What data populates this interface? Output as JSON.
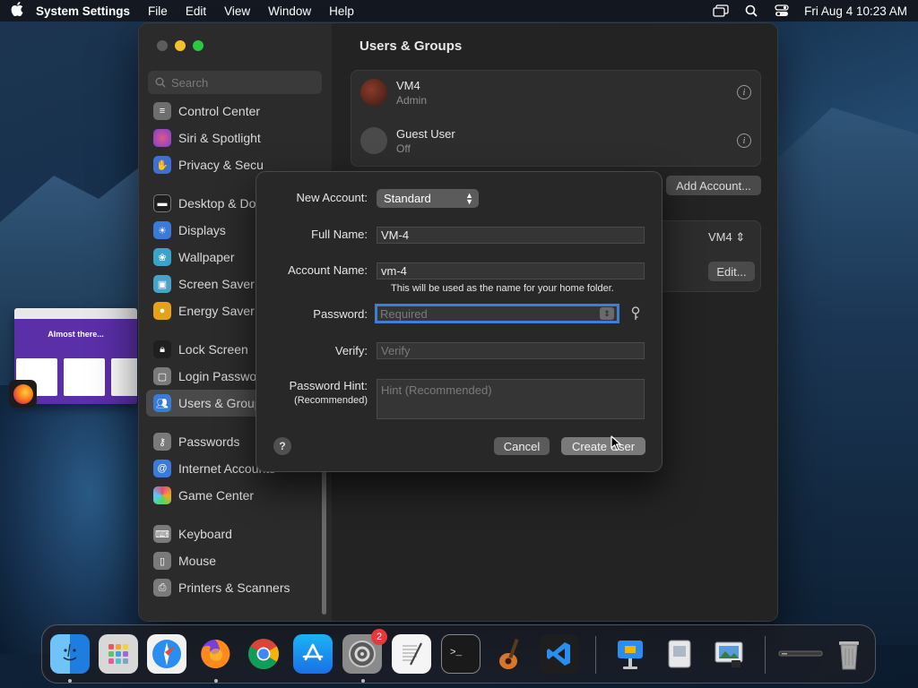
{
  "menubar": {
    "app_name": "System Settings",
    "items": [
      "File",
      "Edit",
      "View",
      "Window",
      "Help"
    ],
    "clock": "Fri Aug 4  10:23 AM"
  },
  "sidebar": {
    "search_placeholder": "Search",
    "items": [
      {
        "label": "Control Center",
        "icon": "control-center-icon",
        "color": "#6e6e6e"
      },
      {
        "label": "Siri & Spotlight",
        "icon": "siri-icon",
        "color": "#c23fa0"
      },
      {
        "label": "Privacy & Secu",
        "icon": "hand-icon",
        "color": "#3e6fd1"
      },
      {
        "label": "Desktop & Doc",
        "icon": "desktop-icon",
        "color": "#1f1f1f"
      },
      {
        "label": "Displays",
        "icon": "sun-icon",
        "color": "#3b7bd8"
      },
      {
        "label": "Wallpaper",
        "icon": "wallpaper-icon",
        "color": "#3aa3c9"
      },
      {
        "label": "Screen Saver",
        "icon": "screensaver-icon",
        "color": "#47a3c8"
      },
      {
        "label": "Energy Saver",
        "icon": "bulb-icon",
        "color": "#e5a11a"
      },
      {
        "label": "Lock Screen",
        "icon": "lock-icon",
        "color": "#1f1f1f"
      },
      {
        "label": "Login Passwor",
        "icon": "login-icon",
        "color": "#7a7a7a"
      },
      {
        "label": "Users & Group",
        "icon": "users-icon",
        "color": "#3b7bd8"
      },
      {
        "label": "Passwords",
        "icon": "key-icon",
        "color": "#7a7a7a"
      },
      {
        "label": "Internet Accounts",
        "icon": "at-icon",
        "color": "#3b7bd8"
      },
      {
        "label": "Game Center",
        "icon": "game-center-icon",
        "color": "#e04b7b"
      },
      {
        "label": "Keyboard",
        "icon": "keyboard-icon",
        "color": "#7a7a7a"
      },
      {
        "label": "Mouse",
        "icon": "mouse-icon",
        "color": "#7a7a7a"
      },
      {
        "label": "Printers & Scanners",
        "icon": "printer-icon",
        "color": "#7a7a7a"
      }
    ]
  },
  "main": {
    "title": "Users & Groups",
    "users": [
      {
        "name": "VM4",
        "role": "Admin"
      },
      {
        "name": "Guest User",
        "role": "Off"
      }
    ],
    "add_account_label": "Add Account...",
    "autologin_value": "VM4",
    "edit_label": "Edit..."
  },
  "dialog": {
    "new_account_label": "New Account:",
    "account_type": "Standard",
    "full_name_label": "Full Name:",
    "full_name_value": "VM-4",
    "account_name_label": "Account Name:",
    "account_name_value": "vm-4",
    "account_name_note": "This will be used as the name for your home folder.",
    "password_label": "Password:",
    "password_placeholder": "Required",
    "verify_label": "Verify:",
    "verify_placeholder": "Verify",
    "hint_label": "Password Hint:",
    "hint_sublabel": "(Recommended)",
    "hint_placeholder": "Hint (Recommended)",
    "cancel_label": "Cancel",
    "create_label": "Create User",
    "help_glyph": "?"
  },
  "thumbnail": {
    "title": "Almost there..."
  },
  "dock": {
    "settings_badge": "2",
    "apps": [
      "finder-icon",
      "launchpad-icon",
      "safari-icon",
      "firefox-icon",
      "chrome-icon",
      "app-store-icon",
      "system-settings-icon",
      "textedit-icon",
      "terminal-icon",
      "garageband-icon",
      "vscode-icon",
      "keynote-icon",
      "preview-icon",
      "image-capture-icon",
      "downloads-icon",
      "trash-icon"
    ]
  }
}
